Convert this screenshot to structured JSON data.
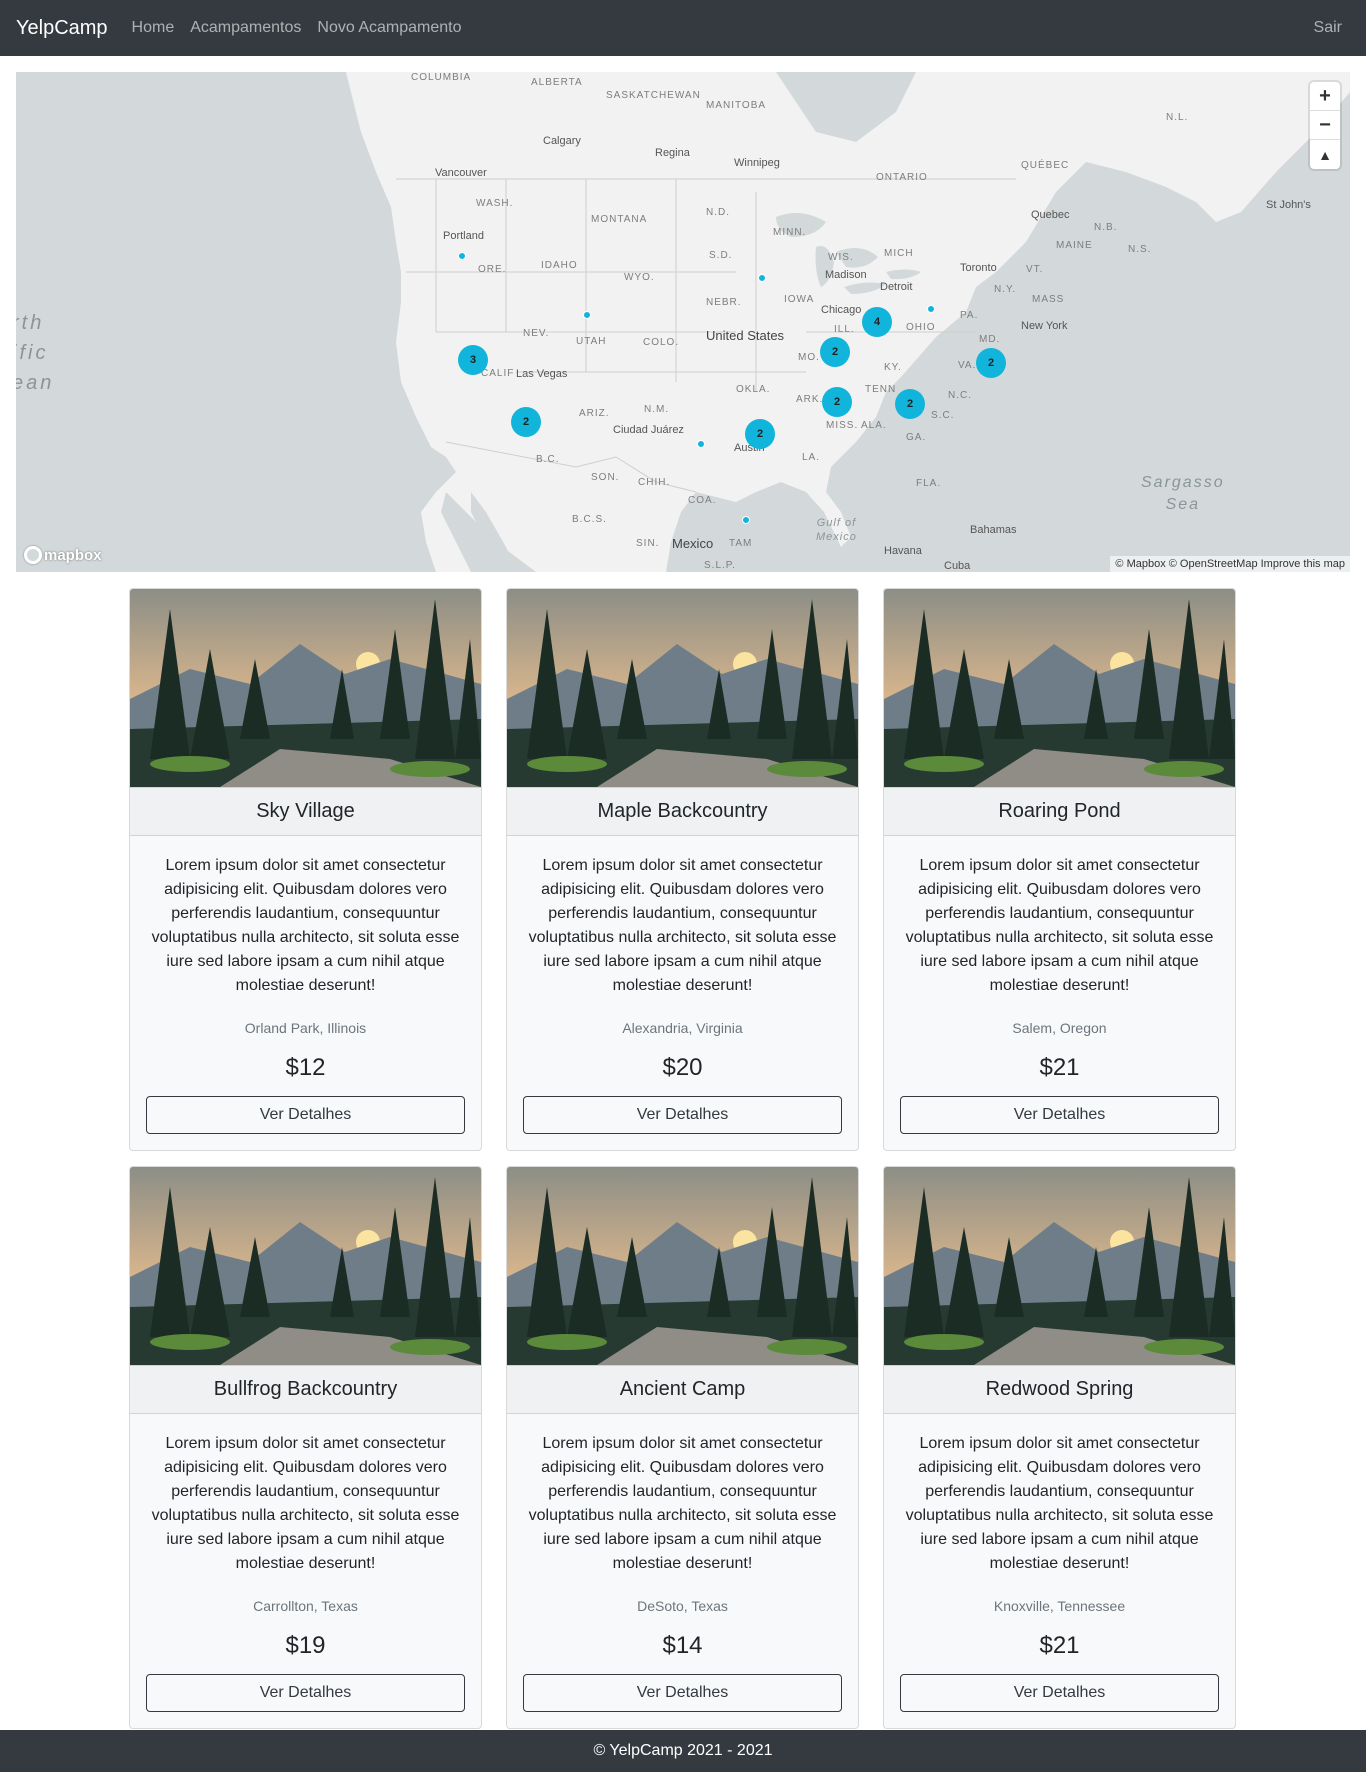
{
  "nav": {
    "brand": "YelpCamp",
    "links": [
      "Home",
      "Acampamentos",
      "Novo Acampamento"
    ],
    "logout": "Sair"
  },
  "map": {
    "ocean_name": "rth\nific\nean",
    "sea_name": "Sargasso\nSea",
    "gulf_name": "Gulf of\nMexico",
    "country_label": "United States",
    "mexico_label": "Mexico",
    "regions": [
      "COLUMBIA",
      "ALBERTA",
      "SASKATCHEWAN",
      "MANITOBA",
      "ONTARIO",
      "QUÉBEC",
      "N.L.",
      "WASH.",
      "MONTANA",
      "N.D.",
      "MINN.",
      "IDAHO",
      "ORE.",
      "WYO.",
      "S.D.",
      "WIS.",
      "MICH",
      "NEBR.",
      "IOWA",
      "ILL.",
      "OHIO",
      "PA.",
      "N.Y.",
      "MASS",
      "NEV.",
      "UTAH",
      "COLO.",
      "MO.",
      "KY.",
      "VA.",
      "MD.",
      "CALIF",
      "OKLA.",
      "TENN",
      "N.C.",
      "ARIZ.",
      "N.M.",
      "ARK.",
      "S.C.",
      "MISS.",
      "ALA.",
      "GA.",
      "LA.",
      "SON.",
      "CHIH.",
      "COA.",
      "FLA.",
      "B.C.S.",
      "SIN.",
      "TAM",
      "S.L.P.",
      "B.C.",
      "MAINE",
      "N.B.",
      "N.S.",
      "VT."
    ],
    "cities": [
      "Calgary",
      "Regina",
      "Winnipeg",
      "Vancouver",
      "Portland",
      "Madison",
      "Chicago",
      "Detroit",
      "Toronto",
      "Quebec",
      "St John's",
      "New York",
      "Las Vegas",
      "Ciudad Juárez",
      "Austin",
      "Havana",
      "Bahamas",
      "Cuba"
    ],
    "clusters": [
      "3",
      "2",
      "2",
      "2",
      "4",
      "2",
      "2",
      "2"
    ],
    "zoom_in": "+",
    "zoom_out": "−",
    "compass": "▲",
    "logo": "mapbox",
    "attribution": "© Mapbox © OpenStreetMap Improve this map"
  },
  "campgrounds": [
    {
      "title": "Sky Village",
      "description": "Lorem ipsum dolor sit amet consectetur adipisicing elit. Quibusdam dolores vero perferendis laudantium, consequuntur voluptatibus nulla architecto, sit soluta esse iure sed labore ipsam a cum nihil atque molestiae deserunt!",
      "location": "Orland Park, Illinois",
      "price": "$12",
      "button": "Ver Detalhes"
    },
    {
      "title": "Maple Backcountry",
      "description": "Lorem ipsum dolor sit amet consectetur adipisicing elit. Quibusdam dolores vero perferendis laudantium, consequuntur voluptatibus nulla architecto, sit soluta esse iure sed labore ipsam a cum nihil atque molestiae deserunt!",
      "location": "Alexandria, Virginia",
      "price": "$20",
      "button": "Ver Detalhes"
    },
    {
      "title": "Roaring Pond",
      "description": "Lorem ipsum dolor sit amet consectetur adipisicing elit. Quibusdam dolores vero perferendis laudantium, consequuntur voluptatibus nulla architecto, sit soluta esse iure sed labore ipsam a cum nihil atque molestiae deserunt!",
      "location": "Salem, Oregon",
      "price": "$21",
      "button": "Ver Detalhes"
    },
    {
      "title": "Bullfrog Backcountry",
      "description": "Lorem ipsum dolor sit amet consectetur adipisicing elit. Quibusdam dolores vero perferendis laudantium, consequuntur voluptatibus nulla architecto, sit soluta esse iure sed labore ipsam a cum nihil atque molestiae deserunt!",
      "location": "Carrollton, Texas",
      "price": "$19",
      "button": "Ver Detalhes"
    },
    {
      "title": "Ancient Camp",
      "description": "Lorem ipsum dolor sit amet consectetur adipisicing elit. Quibusdam dolores vero perferendis laudantium, consequuntur voluptatibus nulla architecto, sit soluta esse iure sed labore ipsam a cum nihil atque molestiae deserunt!",
      "location": "DeSoto, Texas",
      "price": "$14",
      "button": "Ver Detalhes"
    },
    {
      "title": "Redwood Spring",
      "description": "Lorem ipsum dolor sit amet consectetur adipisicing elit. Quibusdam dolores vero perferendis laudantium, consequuntur voluptatibus nulla architecto, sit soluta esse iure sed labore ipsam a cum nihil atque molestiae deserunt!",
      "location": "Knoxville, Tennessee",
      "price": "$21",
      "button": "Ver Detalhes"
    }
  ],
  "footer": {
    "text": "© YelpCamp 2021 - 2021"
  },
  "colors": {
    "navbar": "#343a40",
    "cluster": "#11b4da",
    "water": "#d3d9da",
    "land": "#f2f2f2"
  }
}
